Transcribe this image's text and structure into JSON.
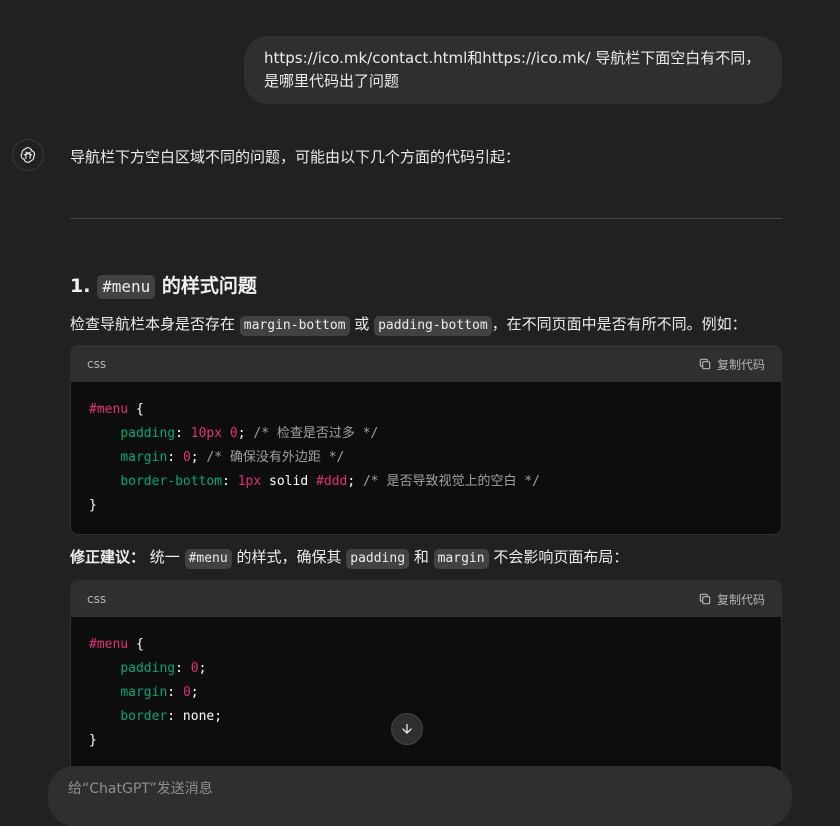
{
  "user_message": {
    "line1": "https://ico.mk/contact.html和https://ico.mk/ 导航栏下面空白有不同，",
    "line2": "是哪里代码出了问题"
  },
  "assistant": {
    "avatar_icon": "openai-logo-icon",
    "intro": "导航栏下方空白区域不同的问题，可能由以下几个方面的代码引起：",
    "section1": {
      "heading_prefix": "1. ",
      "heading_code": "#menu",
      "heading_suffix": " 的样式问题",
      "para_a": "检查导航栏本身是否存在 ",
      "para_code1": "margin-bottom",
      "para_b": " 或 ",
      "para_code2": "padding-bottom",
      "para_c": "，在不同页面中是否有所不同。例如："
    },
    "codeblock1": {
      "lang": "css",
      "copy_label": "复制代码",
      "lines": [
        [
          [
            "sel",
            "#menu"
          ],
          [
            "plain",
            " {"
          ]
        ],
        [
          [
            "plain",
            "    "
          ],
          [
            "prop",
            "padding"
          ],
          [
            "plain",
            ": "
          ],
          [
            "num",
            "10px 0"
          ],
          [
            "plain",
            "; "
          ],
          [
            "cmt",
            "/* 检查是否过多 */"
          ]
        ],
        [
          [
            "plain",
            "    "
          ],
          [
            "prop",
            "margin"
          ],
          [
            "plain",
            ": "
          ],
          [
            "num",
            "0"
          ],
          [
            "plain",
            "; "
          ],
          [
            "cmt",
            "/* 确保没有外边距 */"
          ]
        ],
        [
          [
            "plain",
            "    "
          ],
          [
            "prop",
            "border-bottom"
          ],
          [
            "plain",
            ": "
          ],
          [
            "num",
            "1px"
          ],
          [
            "plain",
            " solid "
          ],
          [
            "num",
            "#ddd"
          ],
          [
            "plain",
            "; "
          ],
          [
            "cmt",
            "/* 是否导致视觉上的空白 */"
          ]
        ],
        [
          [
            "plain",
            "}"
          ]
        ]
      ]
    },
    "fix_para": {
      "bold": "修正建议：",
      "text_a": " 统一 ",
      "code1": "#menu",
      "text_b": " 的样式，确保其 ",
      "code2": "padding",
      "text_c": " 和 ",
      "code3": "margin",
      "text_d": " 不会影响页面布局："
    },
    "codeblock2": {
      "lang": "css",
      "copy_label": "复制代码",
      "lines": [
        [
          [
            "sel",
            "#menu"
          ],
          [
            "plain",
            " {"
          ]
        ],
        [
          [
            "plain",
            "    "
          ],
          [
            "prop",
            "padding"
          ],
          [
            "plain",
            ": "
          ],
          [
            "num",
            "0"
          ],
          [
            "plain",
            ";"
          ]
        ],
        [
          [
            "plain",
            "    "
          ],
          [
            "prop",
            "margin"
          ],
          [
            "plain",
            ": "
          ],
          [
            "num",
            "0"
          ],
          [
            "plain",
            ";"
          ]
        ],
        [
          [
            "plain",
            "    "
          ],
          [
            "prop",
            "border"
          ],
          [
            "plain",
            ": none;"
          ]
        ],
        [
          [
            "plain",
            "}"
          ]
        ]
      ]
    }
  },
  "composer": {
    "placeholder": "给“ChatGPT”发送消息"
  },
  "colors": {
    "background": "#212121",
    "bubble": "#2f2f2f",
    "code_bg": "#0d0d0d",
    "selector": "#df3079",
    "property": "#00a67d",
    "comment": "#a0a0a0"
  }
}
